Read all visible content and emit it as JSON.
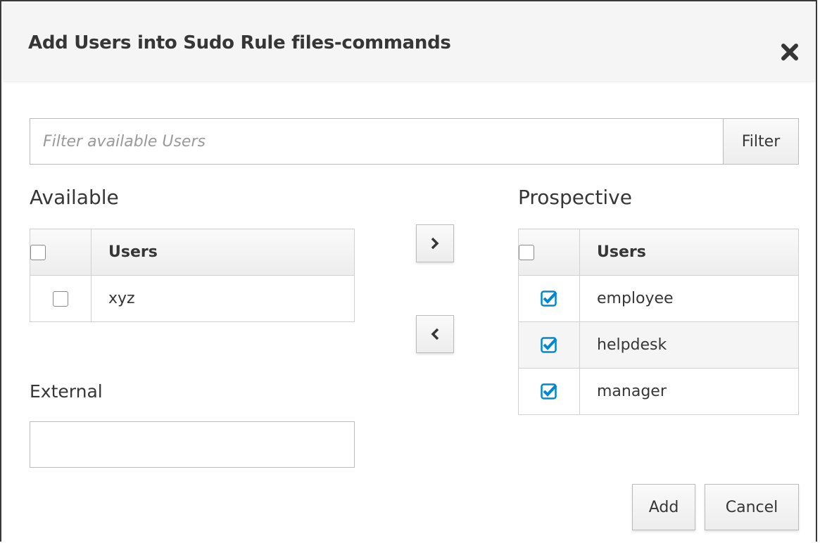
{
  "dialog": {
    "title": "Add Users into Sudo Rule files-commands",
    "close_icon": "close-icon"
  },
  "filter": {
    "placeholder": "Filter available Users",
    "value": "",
    "button_label": "Filter"
  },
  "available": {
    "label": "Available",
    "column_header": "Users",
    "rows": [
      {
        "name": "xyz",
        "checked": false
      }
    ]
  },
  "move": {
    "add_icon": "chevron-right-icon",
    "remove_icon": "chevron-left-icon"
  },
  "prospective": {
    "label": "Prospective",
    "column_header": "Users",
    "rows": [
      {
        "name": "employee",
        "checked": true
      },
      {
        "name": "helpdesk",
        "checked": true
      },
      {
        "name": "manager",
        "checked": true
      }
    ]
  },
  "external": {
    "label": "External",
    "value": ""
  },
  "actions": {
    "add_label": "Add",
    "cancel_label": "Cancel"
  },
  "colors": {
    "checkbox_checked": "#0088ce",
    "header_bg": "#f5f5f5"
  }
}
